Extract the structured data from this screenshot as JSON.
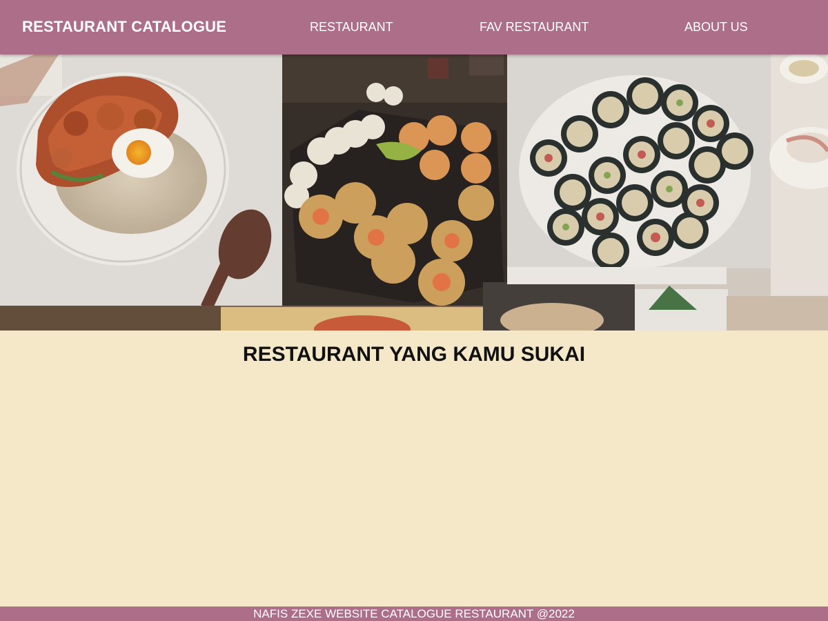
{
  "header": {
    "brand": "RESTAURANT CATALOGUE",
    "nav": [
      "RESTAURANT",
      "FAV RESTAURANT",
      "ABOUT US"
    ]
  },
  "hero": {
    "image": "food-collage"
  },
  "main": {
    "heading": "RESTAURANT YANG KAMU SUKAI"
  },
  "footer": {
    "text": "NAFIS ZEXE WEBSITE CATALOGUE RESTAURANT @2022"
  },
  "colors": {
    "header_bg": "#ac6e89",
    "page_bg": "#f5e8c8",
    "heading": "#111111",
    "nav_text": "#ffffff"
  }
}
